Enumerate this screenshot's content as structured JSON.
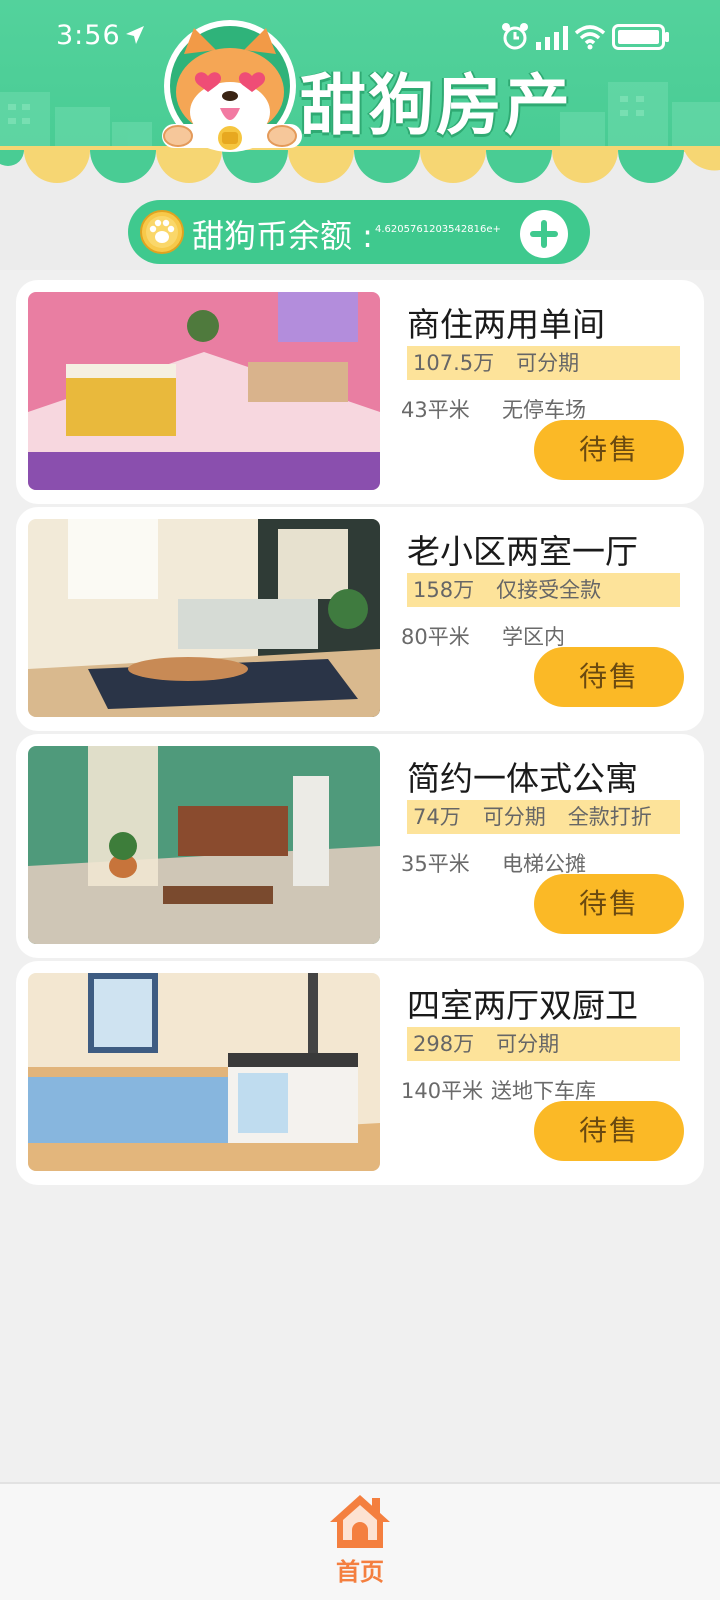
{
  "status_bar": {
    "time": "3:56"
  },
  "header": {
    "app_title": "甜狗房产",
    "coin_label": "甜狗币余额 :",
    "coin_value": "4.6205761203542816e+"
  },
  "listings": [
    {
      "title": "商住两用单间",
      "price_tags": [
        "107.5万",
        "可分期"
      ],
      "area": "43平米",
      "feature": "无停车场",
      "button": "待售"
    },
    {
      "title": "老小区两室一厅",
      "price_tags": [
        "158万",
        "仅接受全款"
      ],
      "area": "80平米",
      "feature": "学区内",
      "button": "待售"
    },
    {
      "title": "简约一体式公寓",
      "price_tags": [
        "74万",
        "可分期",
        "全款打折"
      ],
      "area": "35平米",
      "feature": "电梯公摊",
      "button": "待售"
    },
    {
      "title": "四室两厅双厨卫",
      "price_tags": [
        "298万",
        "可分期"
      ],
      "area": "140平米",
      "feature": "送地下车库",
      "button": "待售"
    }
  ],
  "tab_bar": {
    "home_label": "首页"
  },
  "colors": {
    "brand_green": "#49cc94",
    "price_bg": "#fde39a",
    "button_yellow": "#fbb926",
    "tab_orange": "#f47f3f"
  }
}
